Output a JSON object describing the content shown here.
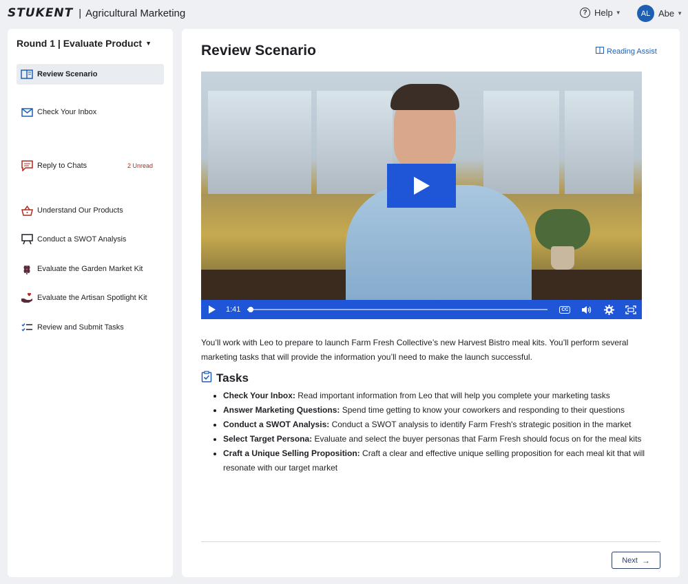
{
  "header": {
    "logo": "STUKENT",
    "separator": "|",
    "app_title": "Agricultural Marketing",
    "help_label": "Help",
    "user_initials": "AL",
    "user_name": "Abe"
  },
  "sidebar": {
    "round_title": "Round 1 | Evaluate Product",
    "items": [
      {
        "label": "Review Scenario",
        "icon": "book-icon",
        "active": true
      },
      {
        "label": "Check Your Inbox",
        "icon": "mail-icon"
      },
      {
        "label": "Reply to Chats",
        "icon": "chat-icon",
        "badge": "2 Unread"
      },
      {
        "label": "Understand Our Products",
        "icon": "basket-icon"
      },
      {
        "label": "Conduct a SWOT Analysis",
        "icon": "presentation-icon"
      },
      {
        "label": "Evaluate the Garden Market Kit",
        "icon": "wheat-icon"
      },
      {
        "label": "Evaluate the Artisan Spotlight Kit",
        "icon": "hand-heart-icon"
      },
      {
        "label": "Review and Submit Tasks",
        "icon": "checklist-icon"
      }
    ]
  },
  "main": {
    "title": "Review Scenario",
    "reading_assist": "Reading Assist",
    "video": {
      "time": "1:41",
      "progress": 0.01
    },
    "intro": "You’ll work with Leo to prepare to launch Farm Fresh Collective’s new Harvest Bistro meal kits. You’ll perform several marketing tasks that will provide the information you’ll need to make the launch successful.",
    "tasks_heading": "Tasks",
    "tasks": [
      {
        "title": "Check Your Inbox:",
        "text": " Read important information from Leo that will help you complete your marketing tasks"
      },
      {
        "title": "Answer Marketing Questions:",
        "text": " Spend time getting to know your coworkers and responding to their questions"
      },
      {
        "title": "Conduct a SWOT Analysis:",
        "text": " Conduct a SWOT analysis to identify Farm Fresh's strategic position in the market"
      },
      {
        "title": "Select Target Persona:",
        "text": " Evaluate and select the buyer personas that Farm Fresh should focus on for the meal kits"
      },
      {
        "title": "Craft a Unique Selling Proposition:",
        "text": " Craft a clear and effective unique selling proposition for each meal kit that will resonate with our target market"
      }
    ],
    "next_label": "Next"
  },
  "colors": {
    "accent": "#1f56d8",
    "badge": "#b3261e",
    "icon_red": "#b3261e",
    "icon_blue": "#1f5fb3"
  }
}
